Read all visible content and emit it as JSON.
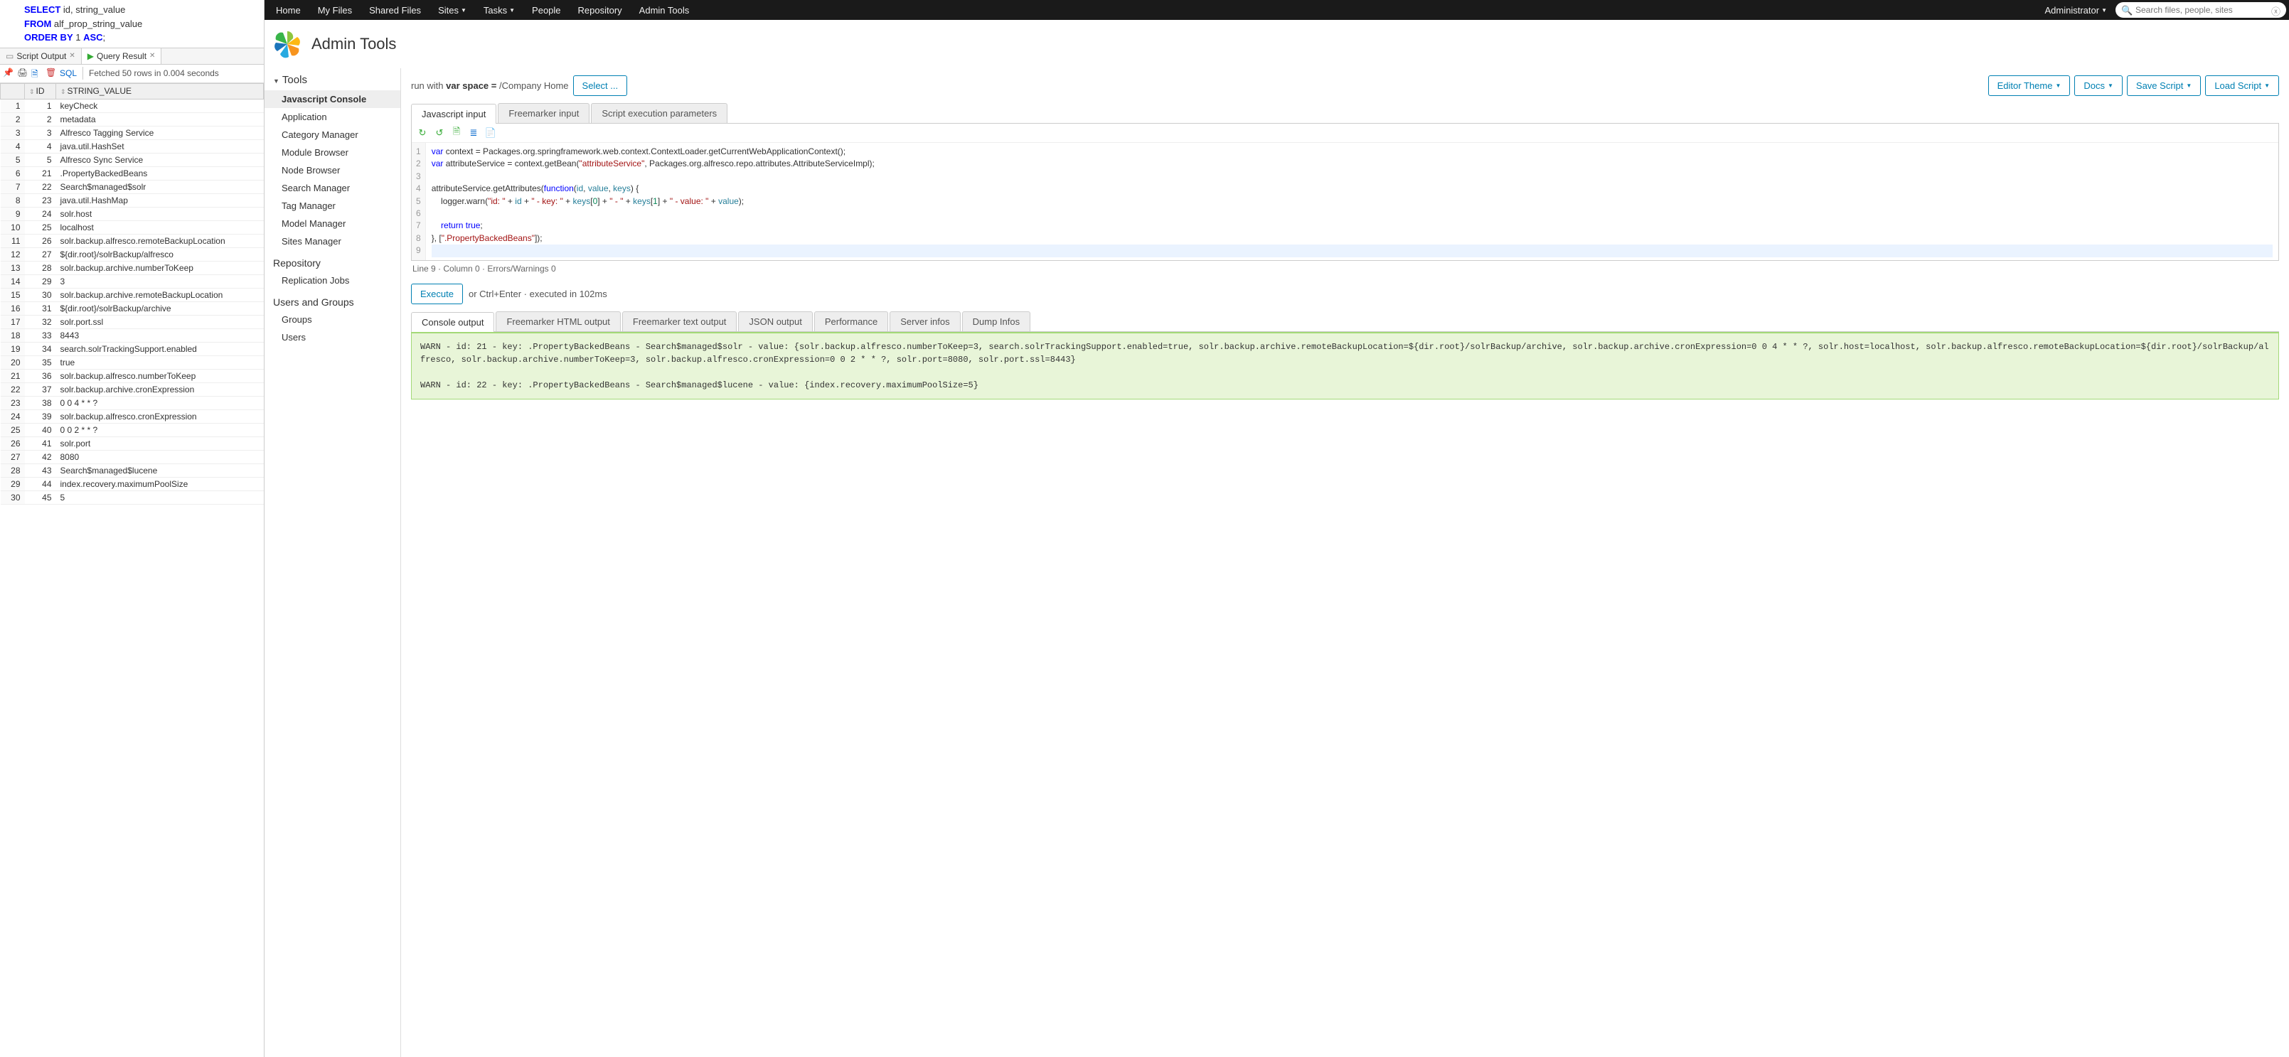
{
  "sql": {
    "lines": [
      {
        "pre": "",
        "kw": "SELECT",
        "mid": " id",
        "s2": ", string_value"
      },
      {
        "pre": "",
        "kw": "FROM",
        "mid": " alf_prop_string_value",
        "s2": ""
      },
      {
        "pre": "",
        "kw": "ORDER BY",
        "mid": " 1 ",
        "kw2": "ASC",
        "s2": ";"
      }
    ],
    "tabs": {
      "script_output": "Script Output",
      "query_result": "Query Result"
    },
    "toolbar": {
      "sql_label": "SQL",
      "fetch_info": "Fetched 50 rows in 0.004 seconds"
    },
    "columns": {
      "id": "ID",
      "value": "STRING_VALUE"
    },
    "rows": [
      {
        "n": 1,
        "id": 1,
        "v": "keyCheck"
      },
      {
        "n": 2,
        "id": 2,
        "v": "metadata"
      },
      {
        "n": 3,
        "id": 3,
        "v": "Alfresco Tagging Service"
      },
      {
        "n": 4,
        "id": 4,
        "v": "java.util.HashSet"
      },
      {
        "n": 5,
        "id": 5,
        "v": "Alfresco Sync Service"
      },
      {
        "n": 6,
        "id": 21,
        "v": ".PropertyBackedBeans"
      },
      {
        "n": 7,
        "id": 22,
        "v": "Search$managed$solr"
      },
      {
        "n": 8,
        "id": 23,
        "v": "java.util.HashMap"
      },
      {
        "n": 9,
        "id": 24,
        "v": "solr.host"
      },
      {
        "n": 10,
        "id": 25,
        "v": "localhost"
      },
      {
        "n": 11,
        "id": 26,
        "v": "solr.backup.alfresco.remoteBackupLocation"
      },
      {
        "n": 12,
        "id": 27,
        "v": "${dir.root}/solrBackup/alfresco"
      },
      {
        "n": 13,
        "id": 28,
        "v": "solr.backup.archive.numberToKeep"
      },
      {
        "n": 14,
        "id": 29,
        "v": "3"
      },
      {
        "n": 15,
        "id": 30,
        "v": "solr.backup.archive.remoteBackupLocation"
      },
      {
        "n": 16,
        "id": 31,
        "v": "${dir.root}/solrBackup/archive"
      },
      {
        "n": 17,
        "id": 32,
        "v": "solr.port.ssl"
      },
      {
        "n": 18,
        "id": 33,
        "v": "8443"
      },
      {
        "n": 19,
        "id": 34,
        "v": "search.solrTrackingSupport.enabled"
      },
      {
        "n": 20,
        "id": 35,
        "v": "true"
      },
      {
        "n": 21,
        "id": 36,
        "v": "solr.backup.alfresco.numberToKeep"
      },
      {
        "n": 22,
        "id": 37,
        "v": "solr.backup.archive.cronExpression"
      },
      {
        "n": 23,
        "id": 38,
        "v": "0 0 4 * * ?"
      },
      {
        "n": 24,
        "id": 39,
        "v": "solr.backup.alfresco.cronExpression"
      },
      {
        "n": 25,
        "id": 40,
        "v": "0 0 2 * * ?"
      },
      {
        "n": 26,
        "id": 41,
        "v": "solr.port"
      },
      {
        "n": 27,
        "id": 42,
        "v": "8080"
      },
      {
        "n": 28,
        "id": 43,
        "v": "Search$managed$lucene"
      },
      {
        "n": 29,
        "id": 44,
        "v": "index.recovery.maximumPoolSize"
      },
      {
        "n": 30,
        "id": 45,
        "v": "5"
      }
    ]
  },
  "topbar": {
    "nav": [
      "Home",
      "My Files",
      "Shared Files",
      "Sites",
      "Tasks",
      "People",
      "Repository",
      "Admin Tools"
    ],
    "nav_dropdown_idx": [
      3,
      4
    ],
    "user": "Administrator",
    "search_placeholder": "Search files, people, sites"
  },
  "header": {
    "title": "Admin Tools"
  },
  "sidebar": {
    "section_tools": "Tools",
    "tools_items": [
      "Javascript Console",
      "Application",
      "Category Manager",
      "Module Browser",
      "Node Browser",
      "Search Manager",
      "Tag Manager",
      "Model Manager",
      "Sites Manager"
    ],
    "active_item": "Javascript Console",
    "section_repo": "Repository",
    "repo_items": [
      "Replication Jobs"
    ],
    "section_users": "Users and Groups",
    "users_items": [
      "Groups",
      "Users"
    ]
  },
  "runbar": {
    "run_with": "run with",
    "var_space": "var space =",
    "space_value": "/Company Home",
    "select_btn": "Select ...",
    "theme_btn": "Editor Theme",
    "docs_btn": "Docs",
    "save_btn": "Save Script",
    "load_btn": "Load Script"
  },
  "input_tabs": [
    "Javascript input",
    "Freemarker input",
    "Script execution parameters"
  ],
  "code_lines": 9,
  "status_line": "Line 9 · Column 0 · Errors/Warnings 0",
  "exec": {
    "btn": "Execute",
    "hint": "or Ctrl+Enter · executed in 102ms"
  },
  "output_tabs": [
    "Console output",
    "Freemarker HTML output",
    "Freemarker text output",
    "JSON output",
    "Performance",
    "Server infos",
    "Dump Infos"
  ],
  "console_output": "WARN - id: 21 - key: .PropertyBackedBeans - Search$managed$solr - value: {solr.backup.alfresco.numberToKeep=3, search.solrTrackingSupport.enabled=true, solr.backup.archive.remoteBackupLocation=${dir.root}/solrBackup/archive, solr.backup.archive.cronExpression=0 0 4 * * ?, solr.host=localhost, solr.backup.alfresco.remoteBackupLocation=${dir.root}/solrBackup/alfresco, solr.backup.archive.numberToKeep=3, solr.backup.alfresco.cronExpression=0 0 2 * * ?, solr.port=8080, solr.port.ssl=8443}\n\nWARN - id: 22 - key: .PropertyBackedBeans - Search$managed$lucene - value: {index.recovery.maximumPoolSize=5}"
}
